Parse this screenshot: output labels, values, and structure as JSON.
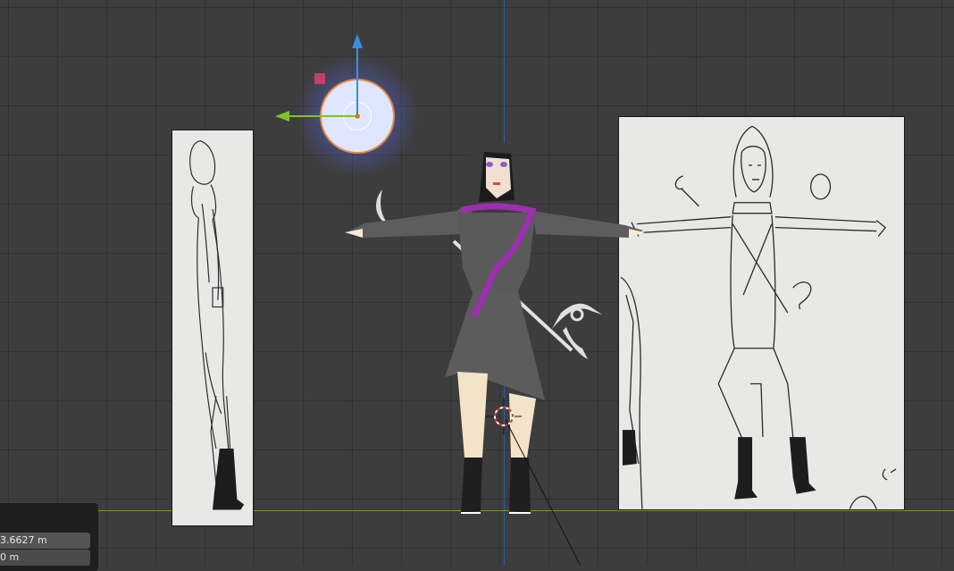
{
  "viewport": {
    "colors": {
      "background": "#3d3d3d",
      "grid": "#333333",
      "z_axis": "#2d5fa0",
      "x_axis": "#6a9a2b",
      "light_disc": "#dfe6ff",
      "light_ring": "#e58a4a",
      "hood": "#3c3c3c",
      "body": "#5e5e5e",
      "sash": "#9b2fae",
      "skin": "#f2e3c9"
    },
    "objects": {
      "light": "point-light",
      "character": "low-poly-character",
      "scythe": "scythe",
      "cursor": "3d-cursor",
      "reference_side": "side-reference-sketch",
      "reference_front": "front-reference-sketch"
    }
  },
  "properties_panel": {
    "field_1": "3.6627 m",
    "field_2": "0 m"
  }
}
